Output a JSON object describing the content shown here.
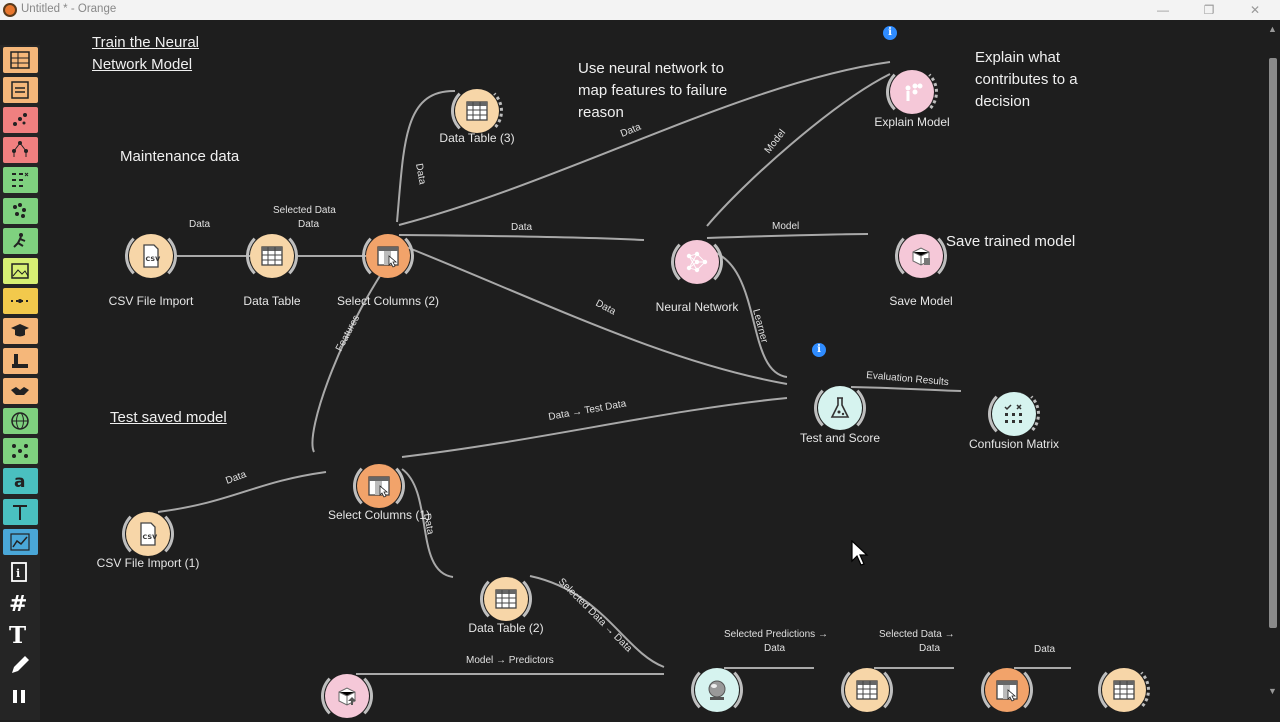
{
  "window": {
    "title": "Untitled * - Orange",
    "minimize": "—",
    "restore": "❐",
    "close": "✕"
  },
  "toolbox": {
    "categories": [
      {
        "icon": "data-table-icon",
        "color": "#f5b77a"
      },
      {
        "icon": "transform-icon",
        "color": "#f5b77a"
      },
      {
        "icon": "scatter-icon",
        "color": "#f08080"
      },
      {
        "icon": "tree-icon",
        "color": "#f08080"
      },
      {
        "icon": "matrix-icon",
        "color": "#7fd17f"
      },
      {
        "icon": "cluster-icon",
        "color": "#7fd17f"
      },
      {
        "icon": "survival-icon",
        "color": "#7fd17f"
      },
      {
        "icon": "image-icon",
        "color": "#d7ef74"
      },
      {
        "icon": "timeline-icon",
        "color": "#f2c94c"
      },
      {
        "icon": "education-icon",
        "color": "#f5b77a"
      },
      {
        "icon": "pipette-icon",
        "color": "#f5b77a"
      },
      {
        "icon": "handshake-icon",
        "color": "#f5b77a"
      },
      {
        "icon": "globe-icon",
        "color": "#7fd17f"
      },
      {
        "icon": "network-icon",
        "color": "#7fd17f"
      },
      {
        "icon": "text-a-icon",
        "color": "#4ac0c0"
      },
      {
        "icon": "text-mining-icon",
        "color": "#4ac0c0"
      },
      {
        "icon": "chart-icon",
        "color": "#4aa7d8"
      }
    ],
    "tools": [
      {
        "icon": "info-doc-icon"
      },
      {
        "icon": "hash-icon",
        "glyph": "#"
      },
      {
        "icon": "text-annotation-icon",
        "glyph": "T"
      },
      {
        "icon": "pencil-icon"
      },
      {
        "icon": "pause-icon"
      }
    ]
  },
  "notes": {
    "train": "Train the Neural Network Model",
    "maintenance": "Maintenance data",
    "use_nn": "Use neural network to map features to failure reason",
    "explain": "Explain what contributes to a decision",
    "save_trained": "Save trained model",
    "test_saved": "Test saved model"
  },
  "nodes": {
    "csv": {
      "label": "CSV File Import",
      "color": "#f7d6a8"
    },
    "data_table": {
      "label": "Data Table",
      "color": "#f7d6a8"
    },
    "select_cols_2": {
      "label": "Select Columns (2)",
      "color": "#f2a36a"
    },
    "data_table_3": {
      "label": "Data Table (3)",
      "color": "#f7d6a8"
    },
    "neural_network": {
      "label": "Neural Network",
      "color": "#f5c8d8"
    },
    "explain_model": {
      "label": "Explain Model",
      "color": "#f5c8d8"
    },
    "save_model": {
      "label": "Save Model",
      "color": "#f5c8d8"
    },
    "test_score": {
      "label": "Test and Score",
      "color": "#d6f3ef"
    },
    "confusion": {
      "label": "Confusion Matrix",
      "color": "#d6f3ef"
    },
    "csv_1": {
      "label": "CSV File Import (1)",
      "color": "#f7d6a8"
    },
    "select_cols_1": {
      "label": "Select Columns (1)",
      "color": "#f2a36a"
    },
    "data_table_2": {
      "label": "Data Table (2)",
      "color": "#f7d6a8"
    },
    "load_model": {
      "label": "",
      "color": "#f5c8d8"
    },
    "predictions": {
      "label": "",
      "color": "#d6f3ef"
    },
    "table_b": {
      "label": "",
      "color": "#f7d6a8"
    },
    "select_b": {
      "label": "",
      "color": "#f2a36a"
    },
    "table_c": {
      "label": "",
      "color": "#f7d6a8"
    }
  },
  "links": {
    "csv_dt": "Data",
    "dt_sel": "Selected Data",
    "dt_sel2": "Data",
    "sel_dt3": "Data",
    "sel_explain": "Data",
    "sel_nn": "Data",
    "nn_explain": "Model",
    "nn_save": "Model",
    "nn_test": "Learner",
    "sel_test": "Data",
    "sel_features": "Features",
    "sel1_test": "Data → Test Data",
    "test_conf": "Evaluation Results",
    "csv1_sel1": "Data",
    "sel1_dt2": "Data",
    "dt2_pred": "Selected Data → Data",
    "load_pred": "Model → Predictors",
    "pred_table": "Selected Predictions → Data",
    "table_select": "Selected Data → Data",
    "select_table": "Data"
  },
  "info_badge": "i"
}
